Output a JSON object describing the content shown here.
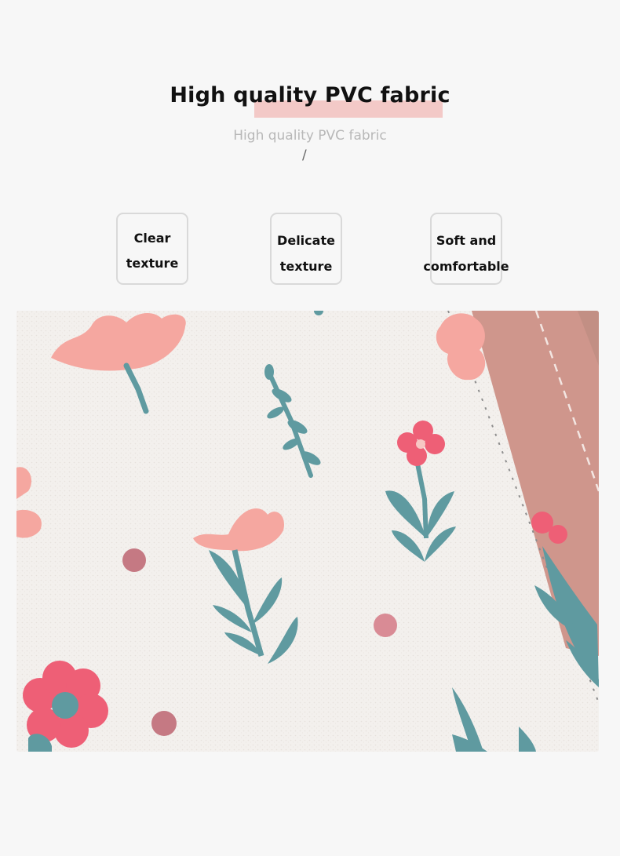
{
  "heading": {
    "title": "High quality PVC fabric",
    "subtitle": "High quality PVC fabric",
    "separator": "/",
    "highlight_color": "#f3c9c7"
  },
  "features": [
    {
      "line1": "Clear",
      "line2": "texture"
    },
    {
      "line1": "Delicate",
      "line2": "texture"
    },
    {
      "line1": "Soft and",
      "line2": "comfortable"
    }
  ],
  "product_image": {
    "subject": "floral-print-pvc-fabric-closeup",
    "colors": {
      "fabric": "#f2efec",
      "pink_flower": "#f5a7a0",
      "red_flower": "#ee5f76",
      "stem": "#5f9aa0",
      "leather_trim": "#cf968c"
    }
  }
}
